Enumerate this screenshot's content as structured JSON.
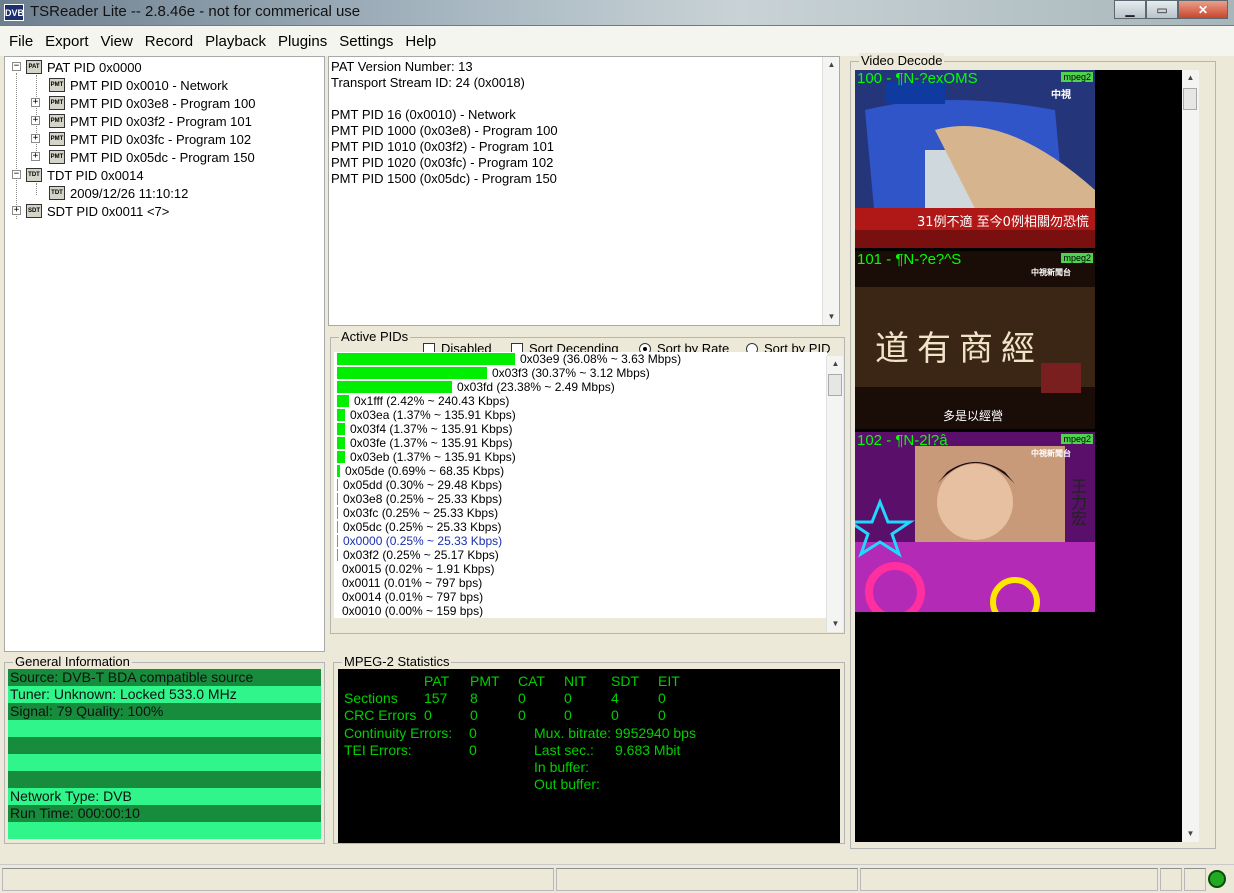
{
  "window": {
    "title": "TSReader Lite -- 2.8.46e - not for commerical use",
    "icon_text": "DVB"
  },
  "menu": [
    "File",
    "Export",
    "View",
    "Record",
    "Playback",
    "Plugins",
    "Settings",
    "Help"
  ],
  "tree": {
    "pat": "PAT PID 0x0000",
    "pmt_network": "PMT PID 0x0010 - Network",
    "pmt_100": "PMT PID 0x03e8 - Program 100",
    "pmt_101": "PMT PID 0x03f2 - Program 101",
    "pmt_102": "PMT PID 0x03fc - Program 102",
    "pmt_150": "PMT PID 0x05dc - Program 150",
    "tdt": "TDT PID 0x0014",
    "tdt_time": "2009/12/26 11:10:12",
    "sdt": "SDT PID 0x0011 <7>",
    "icon_pat": "PAT",
    "icon_pmt": "PMT",
    "icon_tdt": "TDT",
    "icon_sdt": "SDT"
  },
  "info_lines": [
    "PAT Version Number: 13",
    "Transport Stream ID: 24 (0x0018)",
    "",
    "PMT PID 16 (0x0010) - Network",
    "PMT PID 1000 (0x03e8) - Program 100",
    "PMT PID 1010 (0x03f2) - Program 101",
    "PMT PID 1020 (0x03fc) - Program 102",
    "PMT PID 1500 (0x05dc) - Program 150"
  ],
  "active_pids": {
    "label": "Active PIDs",
    "options": {
      "disabled": "Disabled",
      "sort_desc": "Sort Decending",
      "sort_rate": "Sort by Rate",
      "sort_pid": "Sort by PID"
    },
    "rows": [
      {
        "text": "0x03e9 (36.08% ~ 3.63 Mbps)",
        "pct": 36.08
      },
      {
        "text": "0x03f3 (30.37% ~ 3.12 Mbps)",
        "pct": 30.37
      },
      {
        "text": "0x03fd (23.38% ~ 2.49 Mbps)",
        "pct": 23.38
      },
      {
        "text": "0x1fff (2.42% ~ 240.43 Kbps)",
        "pct": 2.42
      },
      {
        "text": "0x03ea (1.37% ~ 135.91 Kbps)",
        "pct": 1.37
      },
      {
        "text": "0x03f4 (1.37% ~ 135.91 Kbps)",
        "pct": 1.37
      },
      {
        "text": "0x03fe (1.37% ~ 135.91 Kbps)",
        "pct": 1.37
      },
      {
        "text": "0x03eb (1.37% ~ 135.91 Kbps)",
        "pct": 1.37
      },
      {
        "text": "0x05de (0.69% ~ 68.35 Kbps)",
        "pct": 0.69
      },
      {
        "text": "0x05dd (0.30% ~ 29.48 Kbps)",
        "pct": 0.3
      },
      {
        "text": "0x03e8 (0.25% ~ 25.33 Kbps)",
        "pct": 0.25
      },
      {
        "text": "0x03fc (0.25% ~ 25.33 Kbps)",
        "pct": 0.25
      },
      {
        "text": "0x05dc (0.25% ~ 25.33 Kbps)",
        "pct": 0.25
      },
      {
        "text": "0x0000 (0.25% ~ 25.33 Kbps)",
        "pct": 0.25,
        "highlight": true
      },
      {
        "text": "0x03f2 (0.25% ~ 25.17 Kbps)",
        "pct": 0.25
      },
      {
        "text": "0x0015 (0.02% ~ 1.91 Kbps)",
        "pct": 0.02
      },
      {
        "text": "0x0011 (0.01% ~ 797 bps)",
        "pct": 0.01
      },
      {
        "text": "0x0014 (0.01% ~ 797 bps)",
        "pct": 0.01
      },
      {
        "text": "0x0010 (0.00% ~ 159 bps)",
        "pct": 0.0
      }
    ]
  },
  "general_info": {
    "label": "General Information",
    "lines": [
      "Source: DVB-T BDA compatible source",
      "Tuner: Unknown: Locked 533.0 MHz",
      "Signal: 79 Quality: 100%",
      "",
      "",
      "",
      "",
      "Network Type: DVB",
      "Run Time: 000:00:10",
      ""
    ]
  },
  "mpeg_stats": {
    "label": "MPEG-2 Statistics",
    "headers": [
      "PAT",
      "PMT",
      "CAT",
      "NIT",
      "SDT",
      "EIT"
    ],
    "sections_label": "Sections",
    "sections": [
      "157",
      "8",
      "0",
      "0",
      "4",
      "0"
    ],
    "crc_label": "CRC Errors",
    "crc": [
      "0",
      "0",
      "0",
      "0",
      "0",
      "0"
    ],
    "continuity_label": "Continuity Errors:",
    "continuity_value": "0",
    "tei_label": "TEI Errors:",
    "tei_value": "0",
    "mux_label": "Mux. bitrate:",
    "mux_value": "9952940 bps",
    "last_label": "Last sec.:",
    "last_value": "9.683 Mbit",
    "inbuf_label": "In buffer:",
    "outbuf_label": "Out buffer:"
  },
  "video_decode": {
    "label": "Video Decode",
    "thumbs": [
      {
        "label": "100 - ¶N-?exOMS",
        "tag": "mpeg2",
        "caption": "31例不適 至今0例相關勿恐慌",
        "logo": "中視"
      },
      {
        "label": "101 - ¶N-?e?^S",
        "tag": "mpeg2",
        "caption": "多是以經營",
        "sign": "道有商經",
        "logo": "中視新聞台"
      },
      {
        "label": "102 - ¶N-2l?â",
        "tag": "mpeg2",
        "caption": "王力宏",
        "logo": "中視新聞台"
      }
    ]
  }
}
